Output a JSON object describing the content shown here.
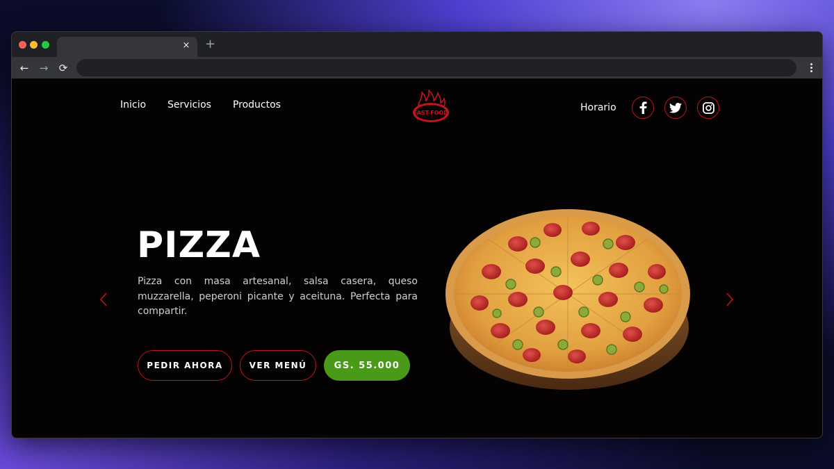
{
  "browser": {
    "tab_close": "×",
    "new_tab": "+",
    "back_icon": "←",
    "forward_icon": "→",
    "reload_icon": "⟳"
  },
  "nav": {
    "links": [
      "Inicio",
      "Servicios",
      "Productos"
    ],
    "horario": "Horario"
  },
  "logo": {
    "text": "FAST-FOOD"
  },
  "hero": {
    "title": "PIZZA",
    "description": "Pizza con masa artesanal, salsa casera, queso muzzarella, peperoni picante y aceituna. Perfecta para compartir.",
    "order_button": "PEDIR AHORA",
    "menu_button": "VER MENÚ",
    "price": "GS. 55.000"
  },
  "colors": {
    "accent_red": "#c0141e",
    "price_green": "#4a9a1a",
    "background": "#050203"
  },
  "icons": [
    "facebook-icon",
    "twitter-icon",
    "instagram-icon",
    "chevron-left-icon",
    "chevron-right-icon"
  ]
}
